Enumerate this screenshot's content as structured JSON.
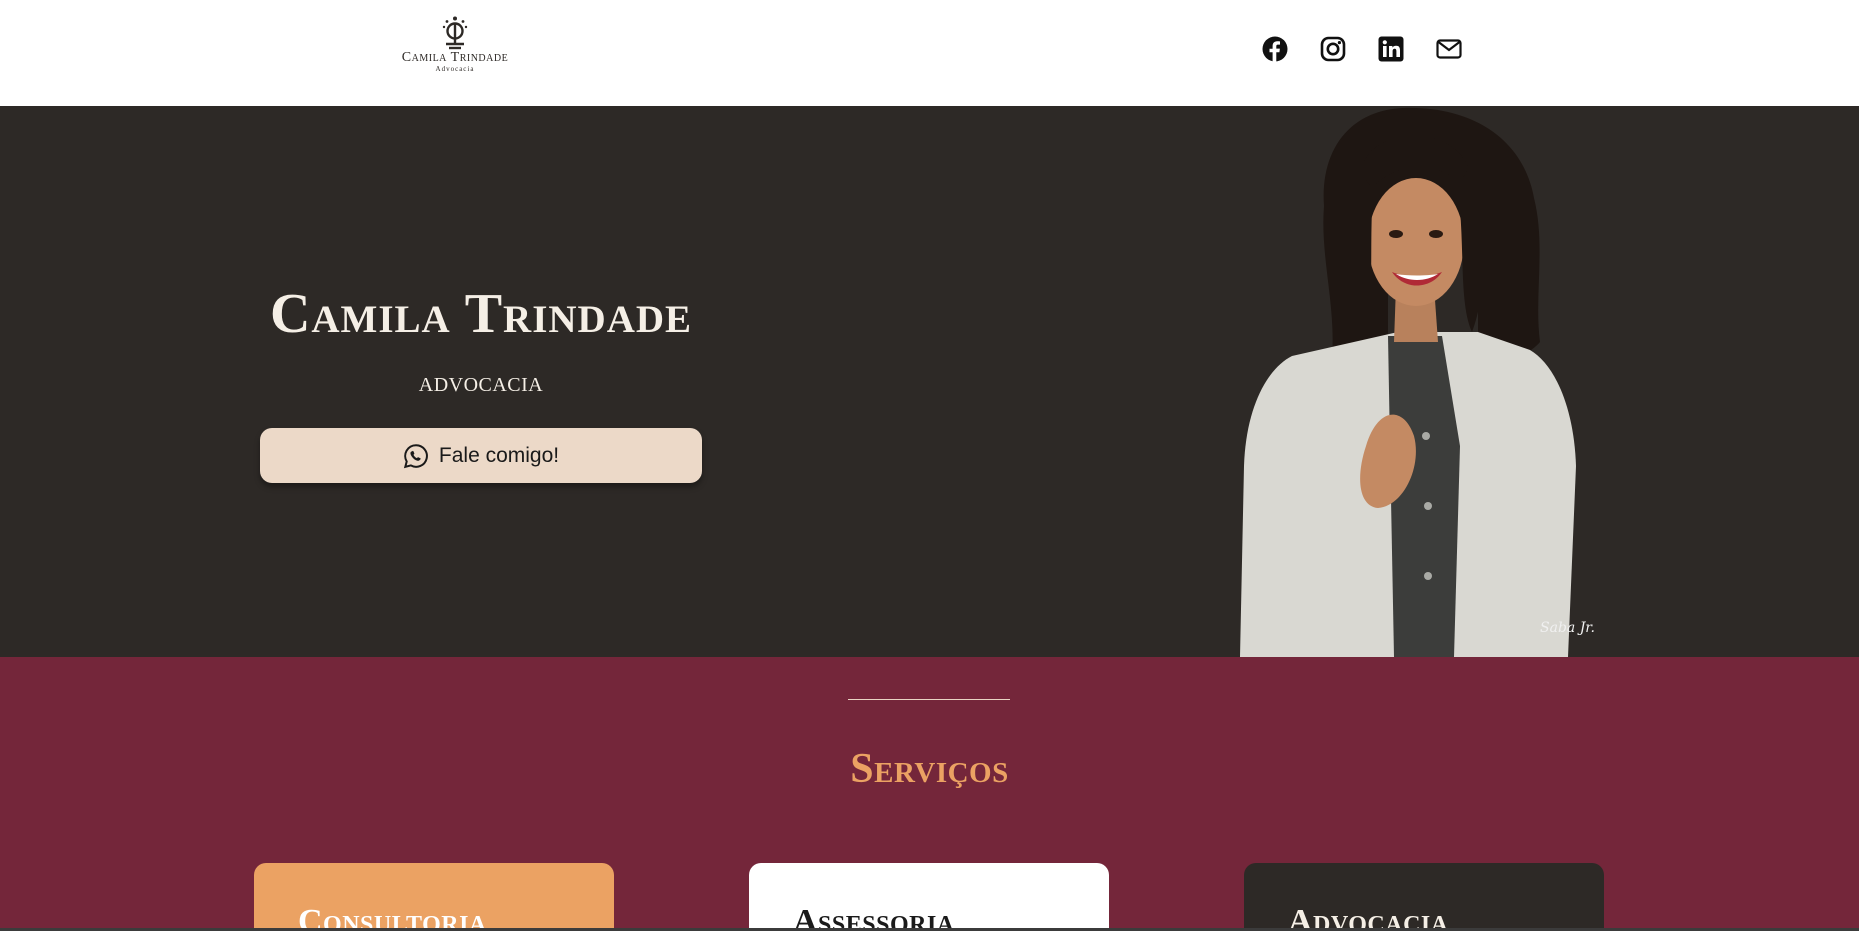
{
  "header": {
    "logo": {
      "name": "Camila Trindade",
      "subtitle": "Advocacia",
      "icon": "scales-of-justice-icon"
    },
    "socials": [
      {
        "name": "facebook",
        "icon": "facebook-icon"
      },
      {
        "name": "instagram",
        "icon": "instagram-icon"
      },
      {
        "name": "linkedin",
        "icon": "linkedin-icon"
      },
      {
        "name": "email",
        "icon": "mail-icon"
      }
    ]
  },
  "hero": {
    "title": "Camila Trindade",
    "subtitle": "ADVOCACIA",
    "cta_label": "Fale comigo!",
    "cta_icon": "whatsapp-icon",
    "signature": "Saba Jr."
  },
  "services": {
    "title": "Serviços",
    "cards": [
      {
        "title": "Consultoria"
      },
      {
        "title": "Assessoria"
      },
      {
        "title": "Advocacia"
      }
    ]
  },
  "colors": {
    "hero_bg": "#2d2926",
    "services_bg": "#74263a",
    "accent": "#eba263",
    "cta_bg": "#ecd9c8",
    "text_light": "#f5efe6"
  }
}
